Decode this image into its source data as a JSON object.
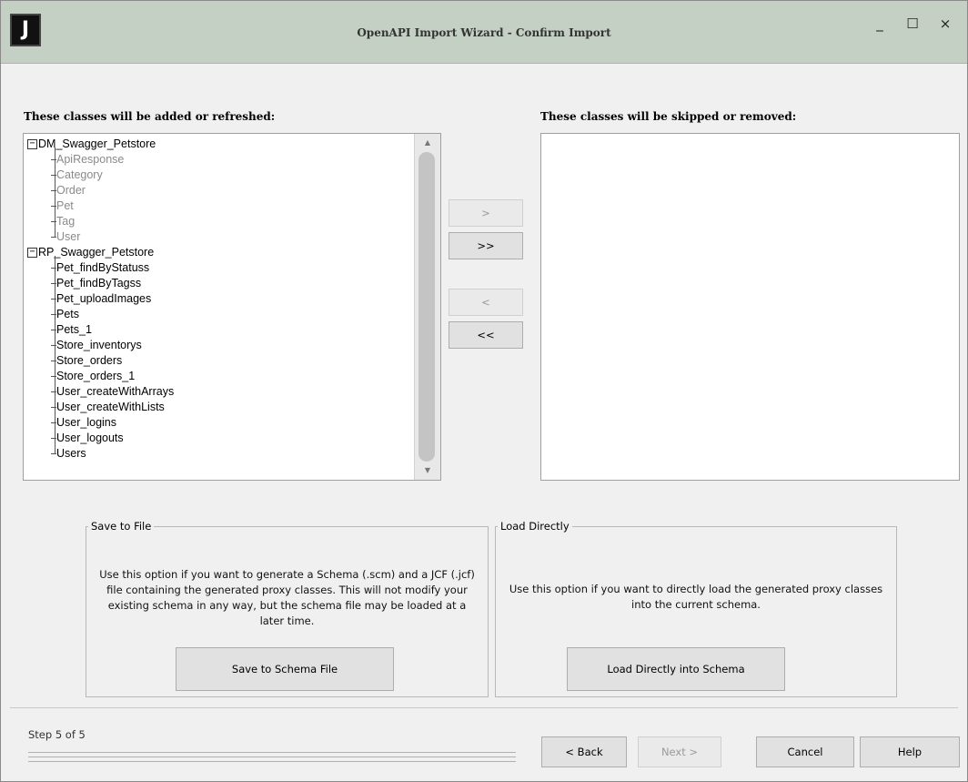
{
  "window": {
    "title": "OpenAPI Import Wizard - Confirm Import",
    "icon_letter": "J",
    "minimize": "_",
    "maximize": "☐",
    "close": "×"
  },
  "left_panel": {
    "label": "These classes will be added or refreshed:",
    "expander_glyph": "−",
    "tree": [
      {
        "name": "DM_Swagger_Petstore",
        "children": [
          {
            "name": "ApiResponse",
            "dimmed": true
          },
          {
            "name": "Category",
            "dimmed": true
          },
          {
            "name": "Order",
            "dimmed": true
          },
          {
            "name": "Pet",
            "dimmed": true
          },
          {
            "name": "Tag",
            "dimmed": true
          },
          {
            "name": "User",
            "dimmed": true
          }
        ]
      },
      {
        "name": "RP_Swagger_Petstore",
        "children": [
          {
            "name": "Pet_findByStatuss",
            "dimmed": false
          },
          {
            "name": "Pet_findByTagss",
            "dimmed": false
          },
          {
            "name": "Pet_uploadImages",
            "dimmed": false
          },
          {
            "name": "Pets",
            "dimmed": false
          },
          {
            "name": "Pets_1",
            "dimmed": false
          },
          {
            "name": "Store_inventorys",
            "dimmed": false
          },
          {
            "name": "Store_orders",
            "dimmed": false
          },
          {
            "name": "Store_orders_1",
            "dimmed": false
          },
          {
            "name": "User_createWithArrays",
            "dimmed": false
          },
          {
            "name": "User_createWithLists",
            "dimmed": false
          },
          {
            "name": "User_logins",
            "dimmed": false
          },
          {
            "name": "User_logouts",
            "dimmed": false
          },
          {
            "name": "Users",
            "dimmed": false
          }
        ]
      }
    ]
  },
  "right_panel": {
    "label": "These classes will be skipped or removed:",
    "items": []
  },
  "move_buttons": {
    "move_one": ">",
    "move_all": ">>",
    "back_one": "<",
    "back_all": "<<"
  },
  "save_group": {
    "legend": "Save to File",
    "description": "Use this option if you want to generate a Schema (.scm) and a JCF (.jcf) file containing the generated proxy classes. This will not modify your existing schema in any way, but the schema file may be loaded at a later time.",
    "button": "Save to Schema File"
  },
  "load_group": {
    "legend": "Load Directly",
    "description": "Use this option if you want to directly load the generated proxy classes into the current schema.",
    "button": "Load Directly into Schema"
  },
  "footer": {
    "step": "Step 5 of 5",
    "back": "< Back",
    "next": "Next >",
    "cancel": "Cancel",
    "help": "Help"
  },
  "colors": {
    "titlebar": "#c4d0c4",
    "dimmed_text": "#8a8a8a"
  }
}
